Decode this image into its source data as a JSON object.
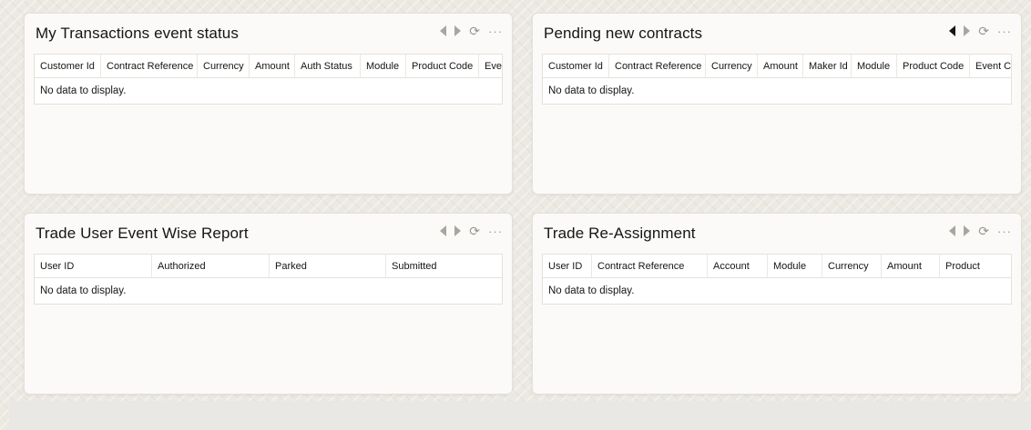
{
  "cards": [
    {
      "title": "My Transactions event status",
      "columns": [
        "Customer Id",
        "Contract Reference",
        "Currency",
        "Amount",
        "Auth Status",
        "Module",
        "Product Code",
        "Event"
      ],
      "empty_text": "No data to display."
    },
    {
      "title": "Pending new contracts",
      "columns": [
        "Customer Id",
        "Contract Reference",
        "Currency",
        "Amount",
        "Maker Id",
        "Module",
        "Product Code",
        "Event Co"
      ],
      "empty_text": "No data to display."
    },
    {
      "title": "Trade User Event Wise Report",
      "columns": [
        "User ID",
        "Authorized",
        "Parked",
        "Submitted"
      ],
      "empty_text": "No data to display."
    },
    {
      "title": "Trade Re-Assignment",
      "columns": [
        "User ID",
        "Contract Reference",
        "Account",
        "Module",
        "Currency",
        "Amount",
        "Product"
      ],
      "empty_text": "No data to display."
    }
  ],
  "icons": {
    "prev": "chevron-left-icon",
    "next": "chevron-right-icon",
    "refresh": "refresh-icon",
    "more": "more-options-icon"
  },
  "colors": {
    "background": "#ece9e2",
    "card": "#fbfaf8",
    "border": "#e4e1da",
    "icon": "#a9a59e",
    "text": "#161513"
  }
}
